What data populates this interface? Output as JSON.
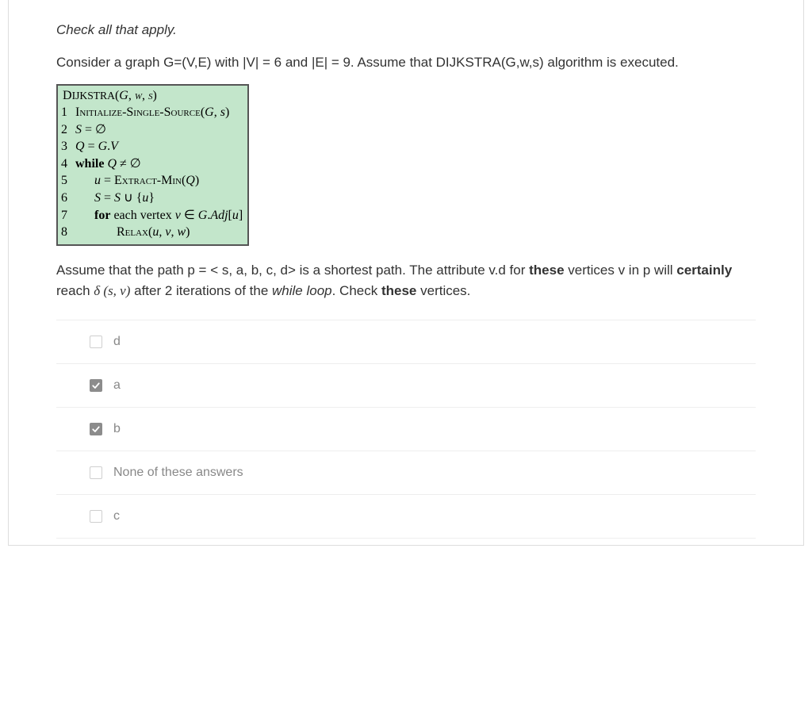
{
  "instruction": "Check all that apply.",
  "prompt": "Consider a graph G=(V,E) with |V| = 6 and |E| = 9.  Assume that DIJKSTRA(G,w,s) algorithm is executed.",
  "pseudo": {
    "header": "Dijkstra(G, w, s)",
    "lines": [
      {
        "n": "1",
        "kind": "sc",
        "text": "Initialize-Single-Source(G, s)"
      },
      {
        "n": "2",
        "kind": "math",
        "text": "S = ∅"
      },
      {
        "n": "3",
        "kind": "math",
        "text": "Q = G.V"
      },
      {
        "n": "4",
        "kind": "while",
        "text": "while Q ≠ ∅"
      },
      {
        "n": "5",
        "kind": "ind1a",
        "text": "u = Extract-Min(Q)"
      },
      {
        "n": "6",
        "kind": "ind1b",
        "text": "S = S ∪ {u}"
      },
      {
        "n": "7",
        "kind": "ind1c",
        "text": "for each vertex v ∈ G.Adj[u]"
      },
      {
        "n": "8",
        "kind": "ind2",
        "text": "Relax(u, v, w)"
      }
    ]
  },
  "question": {
    "pre": "Assume that the path p = < s, a, b, c, d> is a shortest path. The attribute v.d for ",
    "bold1": "these",
    "mid1": " vertices v in p will ",
    "bold2": "certainly",
    "mid2": " reach ",
    "delta": "δ (s, v)",
    "mid3": " after 2 iterations of the ",
    "ital": "while loop",
    "mid4": ". Check ",
    "bold3": "these",
    "end": " vertices."
  },
  "answers": [
    {
      "id": "d",
      "label": "d",
      "checked": false
    },
    {
      "id": "a",
      "label": "a",
      "checked": true
    },
    {
      "id": "b",
      "label": "b",
      "checked": true
    },
    {
      "id": "none",
      "label": "None of these answers",
      "checked": false
    },
    {
      "id": "c",
      "label": "c",
      "checked": false
    }
  ]
}
